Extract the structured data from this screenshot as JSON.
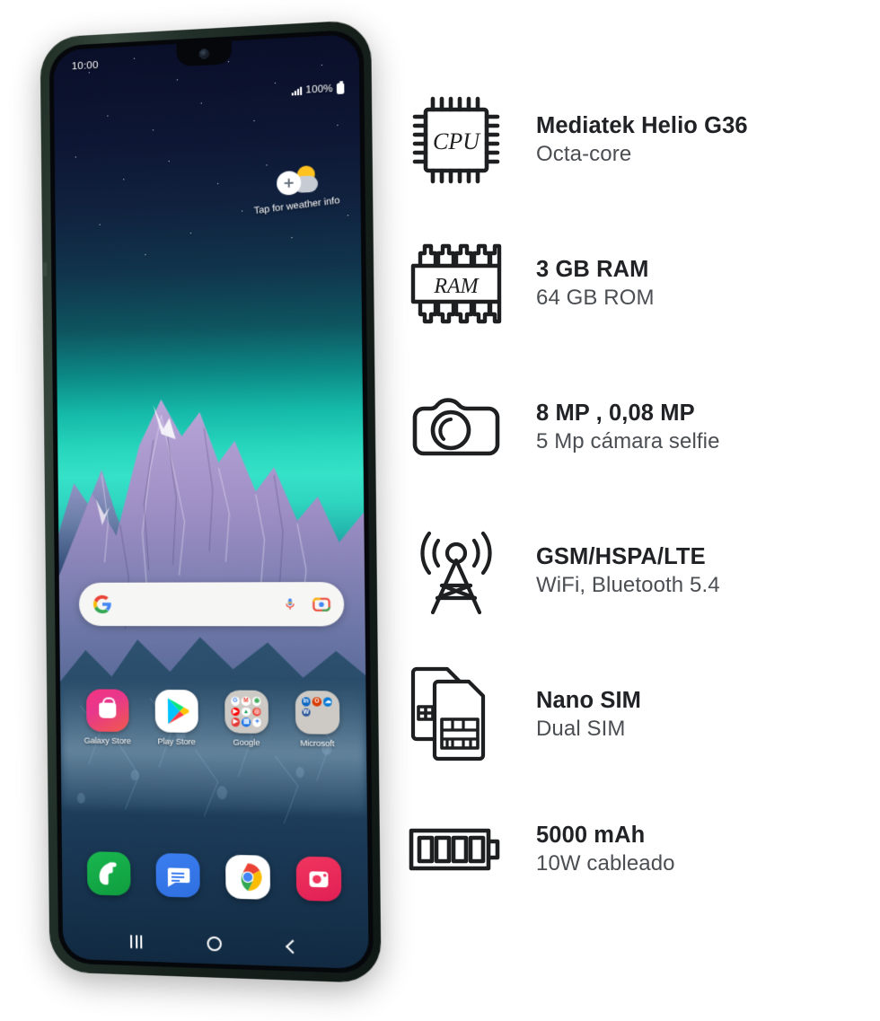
{
  "product": {
    "phone": {
      "status_bar": {
        "time": "10:00",
        "battery_percent": "100%",
        "signal_icon": "signal-bars-icon",
        "battery_icon": "battery-full-icon"
      },
      "weather_widget": {
        "label": "Tap for weather info",
        "icon": "cloud-sun-add-icon"
      },
      "search_bar": {
        "logo_icon": "google-g-icon",
        "mic_icon": "microphone-icon",
        "lens_icon": "google-lens-icon"
      },
      "apps": [
        {
          "label": "Galaxy Store",
          "icon": "galaxy-store-icon"
        },
        {
          "label": "Play Store",
          "icon": "play-store-icon"
        },
        {
          "label": "Google",
          "icon": "google-folder-icon"
        },
        {
          "label": "Microsoft",
          "icon": "microsoft-folder-icon"
        }
      ],
      "dock": [
        {
          "label": "Phone",
          "icon": "phone-icon"
        },
        {
          "label": "Messages",
          "icon": "messages-icon"
        },
        {
          "label": "Chrome",
          "icon": "chrome-icon"
        },
        {
          "label": "Camera",
          "icon": "camera-app-icon"
        }
      ],
      "nav_bar": [
        {
          "label": "Recents",
          "icon": "recents-icon"
        },
        {
          "label": "Home",
          "icon": "home-circle-icon"
        },
        {
          "label": "Back",
          "icon": "back-chevron-icon"
        }
      ]
    },
    "specs": [
      {
        "icon": "cpu-chip-icon",
        "icon_label": "CPU",
        "title": "Mediatek Helio G36",
        "subtitle": "Octa-core"
      },
      {
        "icon": "ram-chip-icon",
        "icon_label": "RAM",
        "title": "3 GB RAM",
        "subtitle": "64 GB ROM"
      },
      {
        "icon": "camera-icon",
        "icon_label": "",
        "title": "8 MP , 0,08 MP",
        "subtitle": "5 Mp cámara selfie"
      },
      {
        "icon": "network-tower-icon",
        "icon_label": "",
        "title": "GSM/HSPA/LTE",
        "subtitle": "WiFi, Bluetooth 5.4"
      },
      {
        "icon": "dual-sim-icon",
        "icon_label": "",
        "title": "Nano SIM",
        "subtitle": "Dual SIM"
      },
      {
        "icon": "battery-icon",
        "icon_label": "",
        "title": "5000 mAh",
        "subtitle": "10W cableado"
      }
    ]
  },
  "colors": {
    "background": "#ffffff",
    "title_text": "#202225",
    "subtitle_text": "#4b4e52",
    "icon_stroke": "#1d1f21",
    "phone_frame": "#1f2d24"
  }
}
